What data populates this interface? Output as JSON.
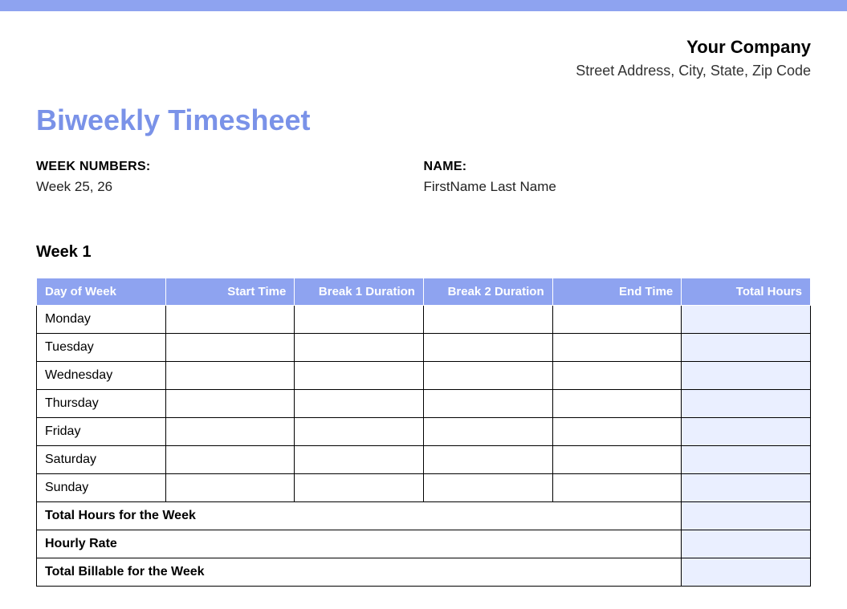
{
  "company": {
    "name": "Your Company",
    "address": "Street Address, City, State, Zip Code"
  },
  "title": "Biweekly Timesheet",
  "info": {
    "week_numbers_label": "WEEK NUMBERS:",
    "week_numbers_value": "Week 25, 26",
    "name_label": "NAME:",
    "name_value": "FirstName Last Name"
  },
  "week1": {
    "heading": "Week 1",
    "headers": {
      "day": "Day of Week",
      "start": "Start Time",
      "break1": "Break 1 Duration",
      "break2": "Break 2 Duration",
      "end": "End Time",
      "total": "Total Hours"
    },
    "days": {
      "mon": "Monday",
      "tue": "Tuesday",
      "wed": "Wednesday",
      "thu": "Thursday",
      "fri": "Friday",
      "sat": "Saturday",
      "sun": "Sunday"
    },
    "summary": {
      "total_hours": "Total Hours for the Week",
      "hourly_rate": "Hourly Rate",
      "total_billable": "Total Billable for the Week"
    }
  }
}
